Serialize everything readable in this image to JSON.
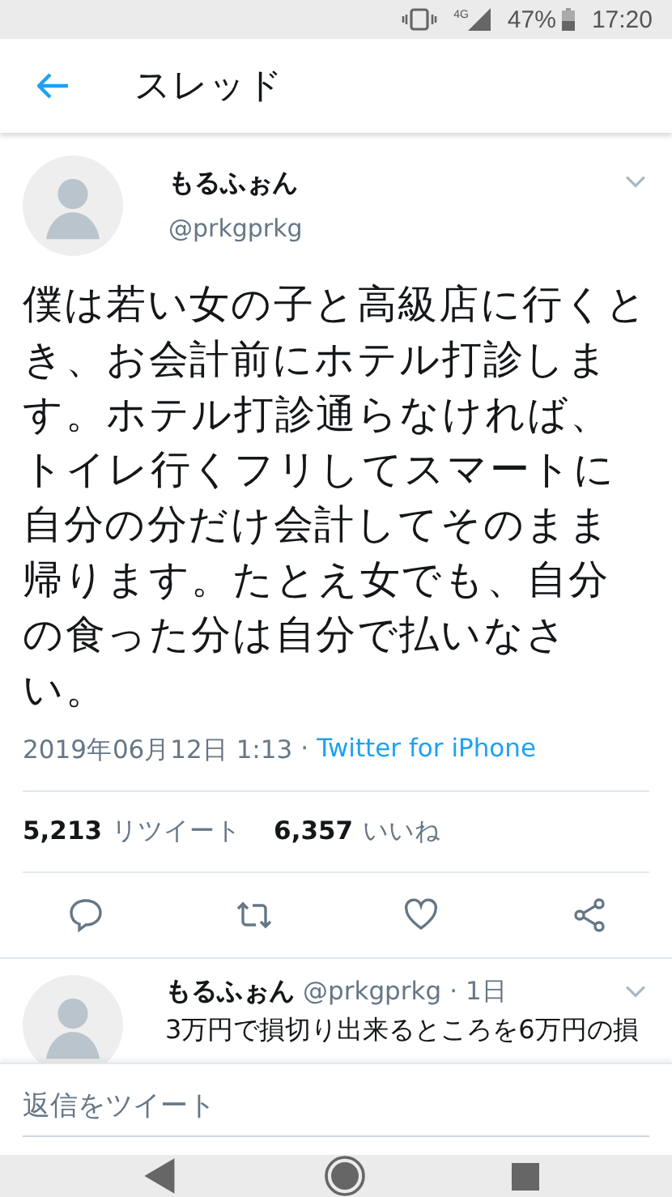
{
  "status_bar": {
    "network": "4G",
    "battery": "47%",
    "time": "17:20"
  },
  "header": {
    "title": "スレッド"
  },
  "tweet": {
    "name": "もるふぉん",
    "handle": "@prkgprkg",
    "text": "僕は若い女の子と高級店に行くとき、お会計前にホテル打診します。ホテル打診通らなければ、トイレ行くフリしてスマートに自分の分だけ会計してそのまま帰ります。たとえ女でも、自分の食った分は自分で払いなさい。",
    "date": "2019年06月12日 1:13",
    "separator": "·",
    "source": "Twitter for iPhone",
    "retweets": "5,213",
    "retweets_label": "リツイート",
    "likes": "6,357",
    "likes_label": "いいね"
  },
  "reply": {
    "name": "もるふぉん",
    "handle": "@prkgprkg",
    "separator": "·",
    "age": "1日",
    "text": "3万円で損切り出来るところを6万円の損"
  },
  "composer": {
    "placeholder": "返信をツイート"
  }
}
